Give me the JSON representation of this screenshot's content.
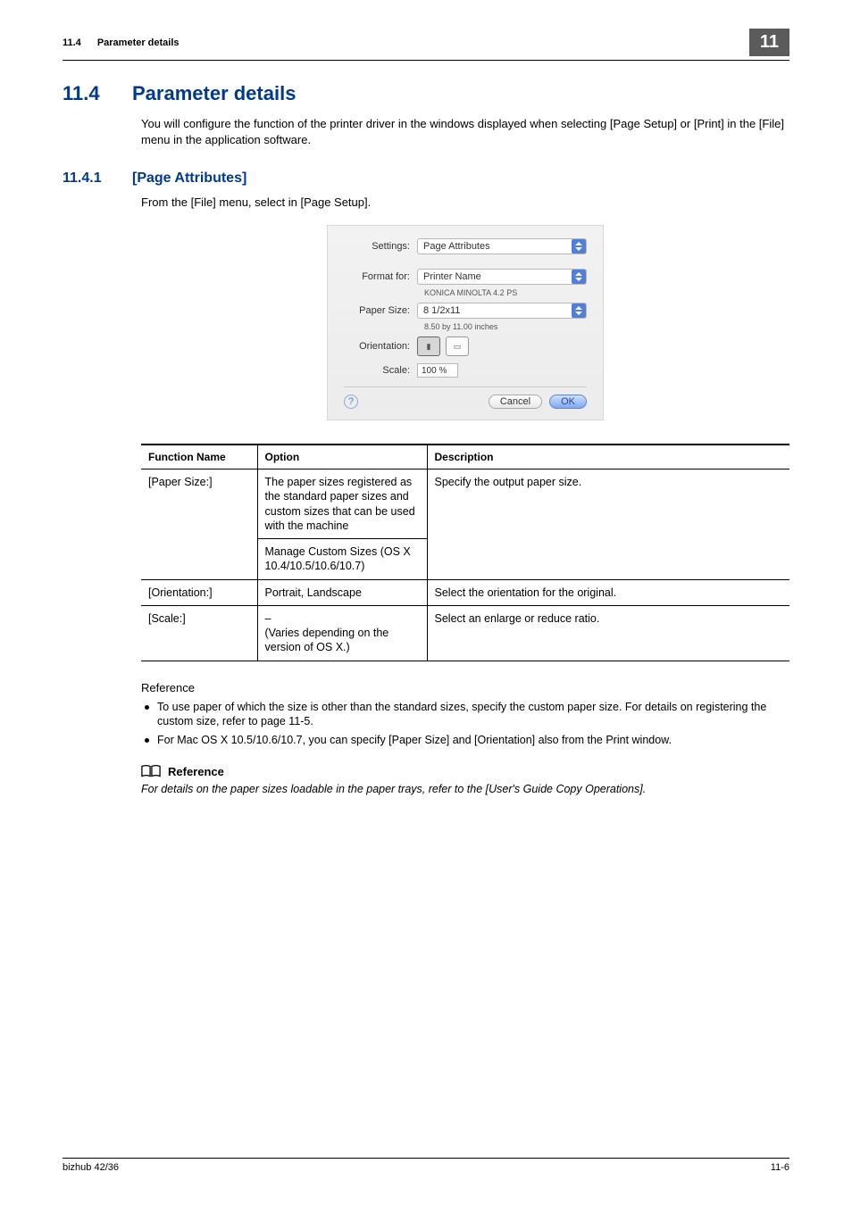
{
  "header": {
    "section_no": "11.4",
    "section_title": "Parameter details",
    "chapter_no": "11"
  },
  "h1": {
    "num": "11.4",
    "title": "Parameter details",
    "intro": "You will configure the function of the printer driver in the windows displayed when selecting [Page Setup] or [Print] in the [File] menu in the application software."
  },
  "h2": {
    "num": "11.4.1",
    "title": "[Page Attributes]",
    "intro": "From the [File] menu, select in [Page Setup]."
  },
  "dialog": {
    "settings_label": "Settings:",
    "settings_value": "Page Attributes",
    "format_label": "Format for:",
    "format_value": "Printer Name",
    "format_note": "KONICA MINOLTA 4.2 PS",
    "paper_label": "Paper Size:",
    "paper_value": "8 1/2x11",
    "paper_note": "8.50 by 11.00 inches",
    "orient_label": "Orientation:",
    "scale_label": "Scale:",
    "scale_value": "100 %",
    "cancel": "Cancel",
    "ok": "OK",
    "help": "?"
  },
  "table": {
    "headers": {
      "fn": "Function Name",
      "opt": "Option",
      "desc": "Description"
    },
    "rows": [
      {
        "fn": "[Paper Size:]",
        "opt1": "The paper sizes registered as the standard paper sizes and custom sizes that can be used with the machine",
        "opt2": "Manage Custom Sizes (OS X 10.4/10.5/10.6/10.7)",
        "desc": "Specify the output paper size."
      },
      {
        "fn": "[Orientation:]",
        "opt": "Portrait, Landscape",
        "desc": "Select the orientation for the original."
      },
      {
        "fn": "[Scale:]",
        "opt": "–\n(Varies depending on the version of OS X.)",
        "desc": "Select an enlarge or reduce ratio."
      }
    ]
  },
  "ref": {
    "heading": "Reference",
    "items": [
      "To use paper of which the size is other than the standard sizes, specify the custom paper size. For details on registering the custom size, refer to page 11-5.",
      "For Mac OS X 10.5/10.6/10.7, you can specify [Paper Size] and [Orientation] also from the Print window."
    ],
    "icon_heading": "Reference",
    "italic": "For details on the paper sizes loadable in the paper trays, refer to the [User's Guide Copy Operations]."
  },
  "footer": {
    "left": "bizhub 42/36",
    "right": "11-6"
  }
}
